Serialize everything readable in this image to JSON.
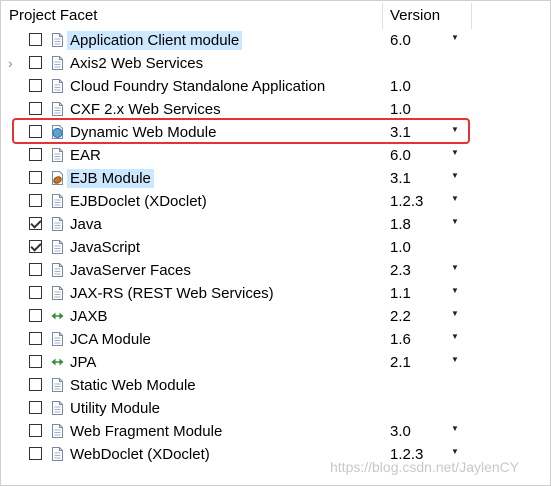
{
  "header": {
    "facet_label": "Project Facet",
    "version_label": "Version"
  },
  "rows": [
    {
      "label": "Application Client module",
      "version": "6.0",
      "dropdown": true,
      "checked": false,
      "icon": "document-icon",
      "expander": false,
      "selected": true
    },
    {
      "label": "Axis2 Web Services",
      "version": "",
      "dropdown": false,
      "checked": false,
      "icon": "document-icon",
      "expander": true,
      "selected": false
    },
    {
      "label": "Cloud Foundry Standalone Application",
      "version": "1.0",
      "dropdown": false,
      "checked": false,
      "icon": "document-icon",
      "expander": false,
      "selected": false
    },
    {
      "label": "CXF 2.x Web Services",
      "version": "1.0",
      "dropdown": false,
      "checked": false,
      "icon": "document-icon",
      "expander": false,
      "selected": false
    },
    {
      "label": "Dynamic Web Module",
      "version": "3.1",
      "dropdown": true,
      "checked": false,
      "icon": "globe-icon",
      "expander": false,
      "selected": false
    },
    {
      "label": "EAR",
      "version": "6.0",
      "dropdown": true,
      "checked": false,
      "icon": "document-icon",
      "expander": false,
      "selected": false
    },
    {
      "label": "EJB Module",
      "version": "3.1",
      "dropdown": true,
      "checked": false,
      "icon": "bean-icon",
      "expander": false,
      "selected": true
    },
    {
      "label": "EJBDoclet (XDoclet)",
      "version": "1.2.3",
      "dropdown": true,
      "checked": false,
      "icon": "document-icon",
      "expander": false,
      "selected": false
    },
    {
      "label": "Java",
      "version": "1.8",
      "dropdown": true,
      "checked": true,
      "icon": "document-icon",
      "expander": false,
      "selected": false
    },
    {
      "label": "JavaScript",
      "version": "1.0",
      "dropdown": false,
      "checked": true,
      "icon": "document-icon",
      "expander": false,
      "selected": false
    },
    {
      "label": "JavaServer Faces",
      "version": "2.3",
      "dropdown": true,
      "checked": false,
      "icon": "document-icon",
      "expander": false,
      "selected": false
    },
    {
      "label": "JAX-RS (REST Web Services)",
      "version": "1.1",
      "dropdown": true,
      "checked": false,
      "icon": "document-icon",
      "expander": false,
      "selected": false
    },
    {
      "label": "JAXB",
      "version": "2.2",
      "dropdown": true,
      "checked": false,
      "icon": "arrows-icon",
      "expander": false,
      "selected": false
    },
    {
      "label": "JCA Module",
      "version": "1.6",
      "dropdown": true,
      "checked": false,
      "icon": "document-icon",
      "expander": false,
      "selected": false
    },
    {
      "label": "JPA",
      "version": "2.1",
      "dropdown": true,
      "checked": false,
      "icon": "arrows-icon",
      "expander": false,
      "selected": false
    },
    {
      "label": "Static Web Module",
      "version": "",
      "dropdown": false,
      "checked": false,
      "icon": "document-icon",
      "expander": false,
      "selected": false
    },
    {
      "label": "Utility Module",
      "version": "",
      "dropdown": false,
      "checked": false,
      "icon": "document-icon",
      "expander": false,
      "selected": false
    },
    {
      "label": "Web Fragment Module",
      "version": "3.0",
      "dropdown": true,
      "checked": false,
      "icon": "document-icon",
      "expander": false,
      "selected": false
    },
    {
      "label": "WebDoclet (XDoclet)",
      "version": "1.2.3",
      "dropdown": true,
      "checked": false,
      "icon": "document-icon",
      "expander": false,
      "selected": false
    }
  ],
  "watermark": "https://blog.csdn.net/JaylenCY",
  "colors": {
    "highlight_border": "#e53333",
    "selection_bg": "#cce8ff"
  }
}
